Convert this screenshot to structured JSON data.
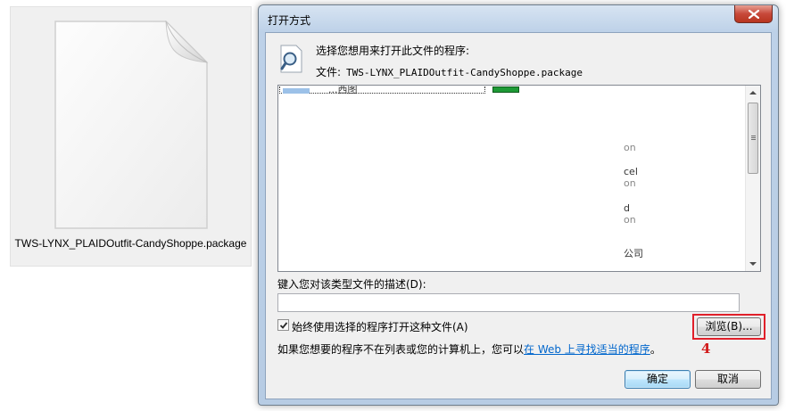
{
  "desktop": {
    "file_name": "TWS-LYNX_PLAIDOutfit-CandyShoppe.package",
    "file_icon": "blank-document-icon"
  },
  "dialog": {
    "title": "打开方式",
    "close_icon": "close-icon",
    "prompt_icon": "magnifier-document-icon",
    "prompt": "选择您想用来打开此文件的程序:",
    "file_label": "文件:",
    "file_value": "TWS-LYNX_PLAIDOutfit-CandyShoppe.package",
    "program_list": {
      "first_item_partial": "...西图",
      "item_fragments": [
        "on",
        "cel",
        "on",
        "d",
        "on",
        "公司"
      ]
    },
    "description_label": "键入您对该类型文件的描述(D):",
    "description_value": "",
    "always_use_checked": true,
    "always_use_label": "始终使用选择的程序打开这种文件(A)",
    "browse_label": "浏览(B)...",
    "info_text": "如果您想要的程序不在列表或您的计算机上，您可以",
    "info_link": "在 Web 上寻找适当的程序",
    "info_suffix": "。",
    "ok_label": "确定",
    "cancel_label": "取消"
  },
  "annotation": {
    "step_number": "4",
    "highlight_color": "#e0202a"
  }
}
